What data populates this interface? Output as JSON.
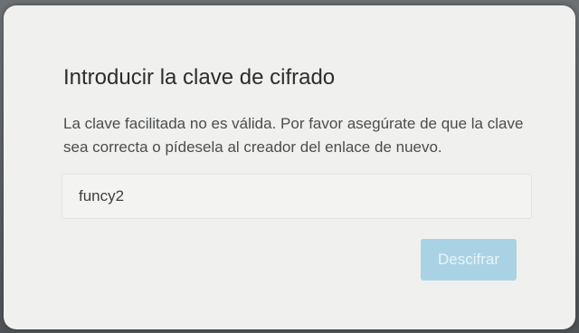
{
  "dialog": {
    "title": "Introducir la clave de cifrado",
    "message": "La clave facilitada no es válida. Por favor asegúrate de que la clave sea correcta o pídesela al creador del enlace de nuevo.",
    "key_input_value": "funcy2",
    "decrypt_button_label": "Descifrar",
    "colors": {
      "button_background": "#a9d3e5",
      "button_text": "#eaf4f8",
      "dialog_background": "#f0f1ee"
    }
  }
}
